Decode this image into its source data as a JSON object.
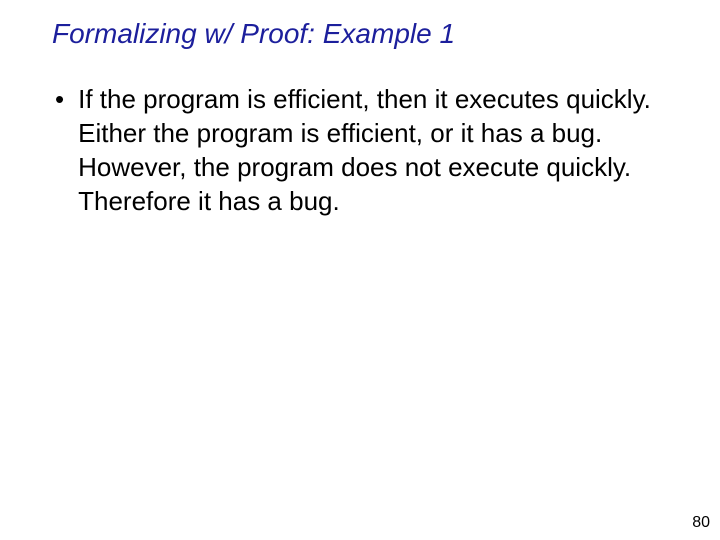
{
  "title": "Formalizing w/ Proof: Example 1",
  "bullets": [
    "If the program is efficient, then it executes quickly. Either the program is efficient, or it has a bug. However, the program does not execute quickly. Therefore it has a bug."
  ],
  "page_number": "80"
}
